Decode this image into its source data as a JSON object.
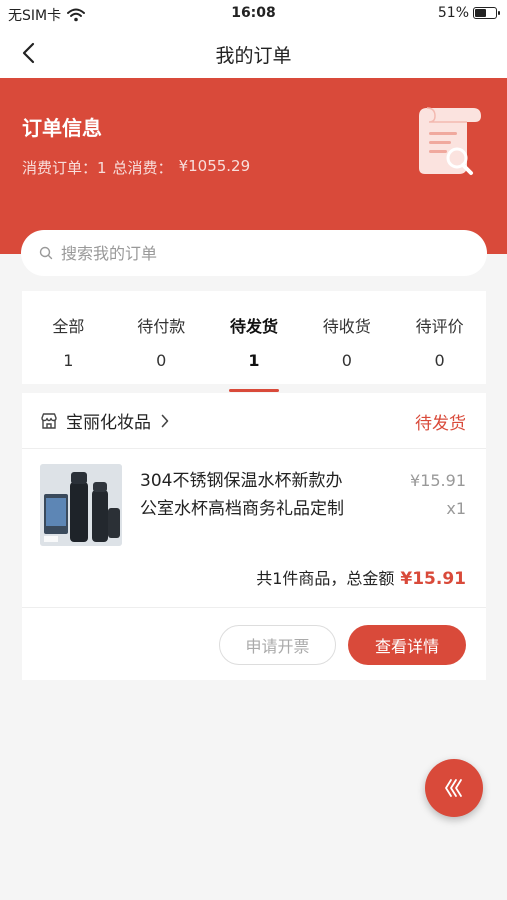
{
  "status_bar": {
    "carrier": "无SIM卡",
    "time": "16:08",
    "battery": "51%"
  },
  "nav": {
    "title": "我的订单"
  },
  "banner": {
    "title": "订单信息",
    "orders_label": "消费订单：1",
    "spend_label": "总消费：",
    "spend_value": "¥1055.29"
  },
  "search": {
    "placeholder": "搜索我的订单"
  },
  "tabs": [
    {
      "label": "全部",
      "count": "1",
      "active": false
    },
    {
      "label": "待付款",
      "count": "0",
      "active": false
    },
    {
      "label": "待发货",
      "count": "1",
      "active": true
    },
    {
      "label": "待收货",
      "count": "0",
      "active": false
    },
    {
      "label": "待评价",
      "count": "0",
      "active": false
    }
  ],
  "order": {
    "shop_name": "宝丽化妆品",
    "status": "待发货",
    "product": {
      "name": "304不锈钢保温水杯新款办公室水杯高档商务礼品定制",
      "price": "¥15.91",
      "quantity": "x1"
    },
    "summary_text": "共1件商品，总金额",
    "total": "¥15.91",
    "buttons": {
      "invoice": "申请开票",
      "detail": "查看详情"
    }
  },
  "colors": {
    "accent": "#d94a3a",
    "background": "#f5f5f5"
  }
}
